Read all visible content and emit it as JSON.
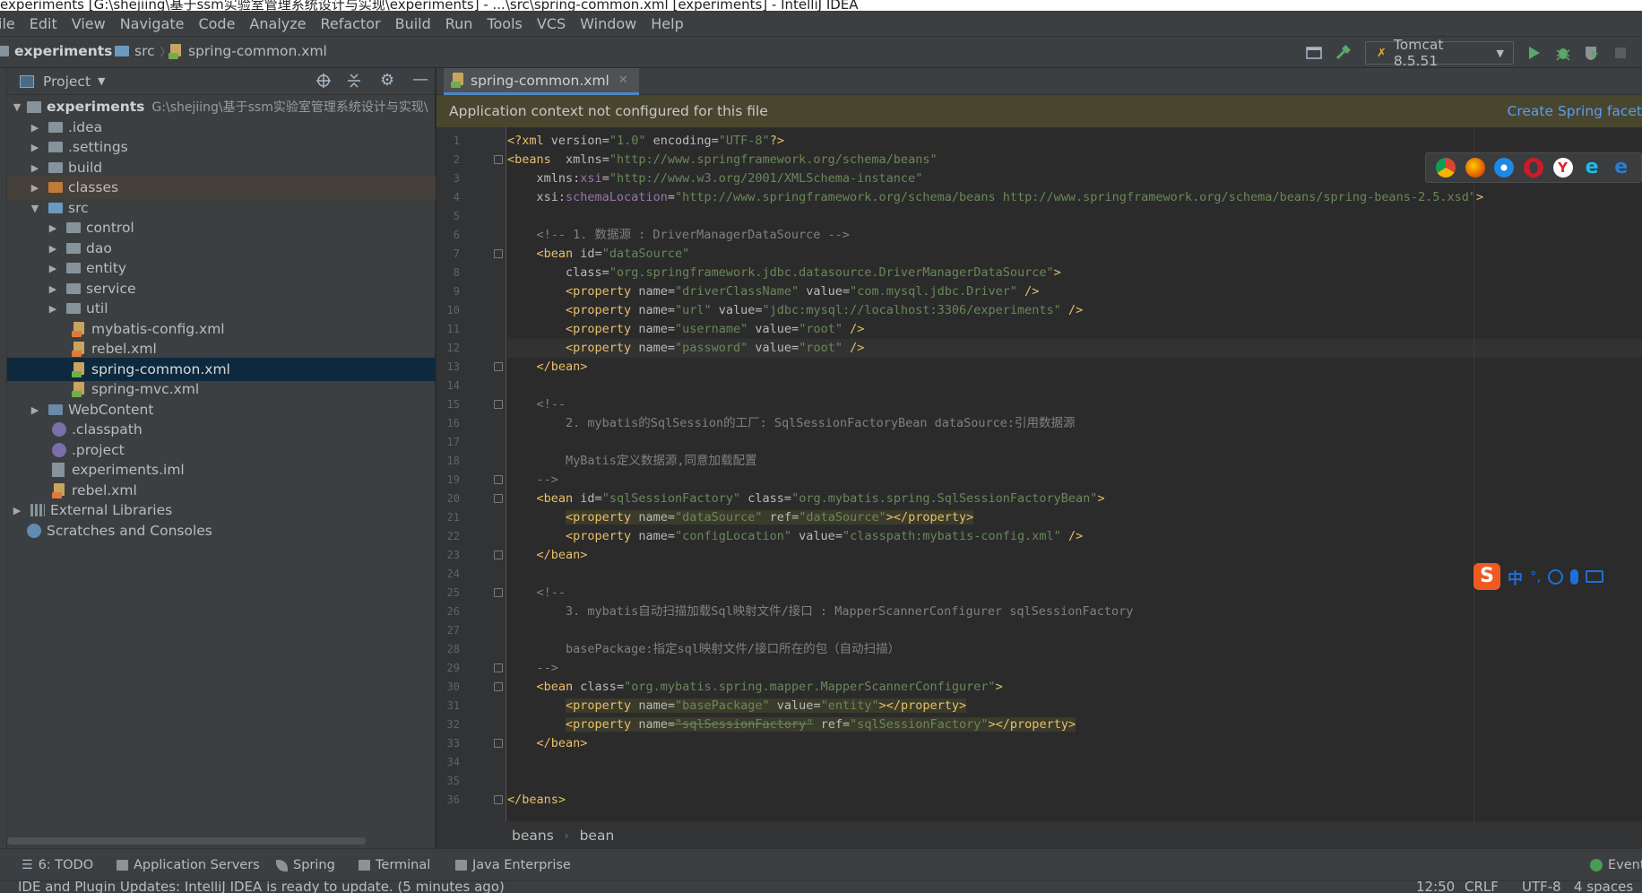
{
  "window": {
    "title": "experiments [G:\\shejiing\\基于ssm实验室管理系统设计与实现\\experiments] - ...\\src\\spring-common.xml [experiments] - IntelliJ IDEA"
  },
  "menu": [
    "ile",
    "Edit",
    "View",
    "Navigate",
    "Code",
    "Analyze",
    "Refactor",
    "Build",
    "Run",
    "Tools",
    "VCS",
    "Window",
    "Help"
  ],
  "navbar": {
    "project": "experiments",
    "folder": "src",
    "file": "spring-common.xml",
    "run_config": "Tomcat 8.5.51"
  },
  "project_panel": {
    "header": "Project",
    "root_name": "experiments",
    "root_path": "G:\\shejiing\\基于ssm实验室管理系统设计与实现\\",
    "items": [
      {
        "label": ".idea"
      },
      {
        "label": ".settings"
      },
      {
        "label": "build"
      },
      {
        "label": "classes"
      },
      {
        "label": "src"
      },
      {
        "label": "control"
      },
      {
        "label": "dao"
      },
      {
        "label": "entity"
      },
      {
        "label": "service"
      },
      {
        "label": "util"
      },
      {
        "label": "mybatis-config.xml"
      },
      {
        "label": "rebel.xml"
      },
      {
        "label": "spring-common.xml"
      },
      {
        "label": "spring-mvc.xml"
      },
      {
        "label": "WebContent"
      },
      {
        "label": ".classpath"
      },
      {
        "label": ".project"
      },
      {
        "label": "experiments.iml"
      },
      {
        "label": "rebel.xml"
      },
      {
        "label": "External Libraries"
      },
      {
        "label": "Scratches and Consoles"
      }
    ]
  },
  "editor": {
    "tab": "spring-common.xml",
    "banner_text": "Application context not configured for this file",
    "banner_link": "Create Spring facet",
    "breadcrumb": [
      "beans",
      "bean"
    ]
  },
  "code_lines": [
    "<?xml version=\"1.0\" encoding=\"UTF-8\"?>",
    "<beans  xmlns=\"http://www.springframework.org/schema/beans\"",
    "    xmlns:xsi=\"http://www.w3.org/2001/XMLSchema-instance\"",
    "    xsi:schemaLocation=\"http://www.springframework.org/schema/beans http://www.springframework.org/schema/beans/spring-beans-2.5.xsd\">",
    "",
    "    <!-- 1. 数据源 : DriverManagerDataSource -->",
    "    <bean id=\"dataSource\"",
    "        class=\"org.springframework.jdbc.datasource.DriverManagerDataSource\">",
    "        <property name=\"driverClassName\" value=\"com.mysql.jdbc.Driver\" />",
    "        <property name=\"url\" value=\"jdbc:mysql://localhost:3306/experiments\" />",
    "        <property name=\"username\" value=\"root\" />",
    "        <property name=\"password\" value=\"root\" />",
    "    </bean>",
    "",
    "    <!--",
    "        2. mybatis的SqlSession的工厂: SqlSessionFactoryBean dataSource:引用数据源",
    "",
    "        MyBatis定义数据源,同意加载配置",
    "    -->",
    "    <bean id=\"sqlSessionFactory\" class=\"org.mybatis.spring.SqlSessionFactoryBean\">",
    "        <property name=\"dataSource\" ref=\"dataSource\"></property>",
    "        <property name=\"configLocation\" value=\"classpath:mybatis-config.xml\" />",
    "    </bean>",
    "",
    "    <!--",
    "        3. mybatis自动扫描加载Sql映射文件/接口 : MapperScannerConfigurer sqlSessionFactory",
    "",
    "        basePackage:指定sql映射文件/接口所在的包（自动扫描）",
    "    -->",
    "    <bean class=\"org.mybatis.spring.mapper.MapperScannerConfigurer\">",
    "        <property name=\"basePackage\" value=\"entity\"></property>",
    "        <property name=\"sqlSessionFactory\" ref=\"sqlSessionFactory\"></property>",
    "    </bean>",
    "",
    "",
    "</beans>"
  ],
  "tool_windows": [
    {
      "label": "6: TODO"
    },
    {
      "label": "Application Servers"
    },
    {
      "label": "Spring"
    },
    {
      "label": "Terminal"
    },
    {
      "label": "Java Enterprise"
    },
    {
      "label": "Event"
    }
  ],
  "status": {
    "message": "IDE and Plugin Updates: IntelliJ IDEA is ready to update. (5 minutes ago)",
    "position": "12:50",
    "line_sep": "CRLF",
    "encoding": "UTF-8",
    "indent": "4 spaces"
  },
  "ime": {
    "label": "中"
  },
  "colors": {
    "tag": "#e8bf6a",
    "attr": "#bababa",
    "value": "#6a8759",
    "comment": "#808080",
    "accent": "#4a88c7",
    "link": "#589df6"
  }
}
